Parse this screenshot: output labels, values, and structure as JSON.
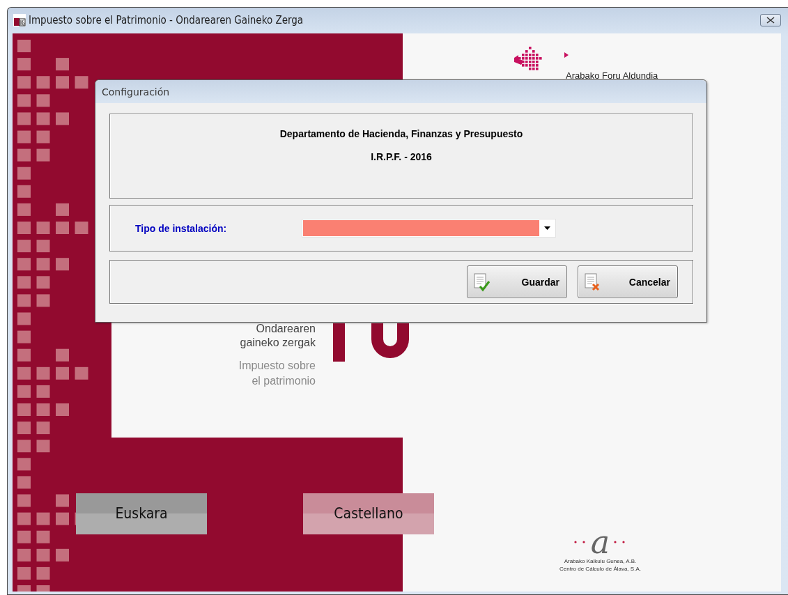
{
  "window": {
    "title": "Impuesto sobre el Patrimonio - Ondarearen Gaineko Zerga"
  },
  "splash": {
    "brand": "Arabako Foru Aldundia",
    "title_eu": [
      "Ondarearen",
      "gaineko zergak"
    ],
    "title_es": [
      "Impuesto sobre",
      "el patrimonio"
    ],
    "language_buttons": [
      {
        "label": "Euskara",
        "color": "#999999"
      },
      {
        "label": "Castellano",
        "color": "#c98c99"
      }
    ],
    "footer_logo": {
      "mark": "a",
      "lines": [
        "Arabako Kalkulu Gunea, A.B.",
        "Centro de Cálculo de Álava, S.A."
      ]
    }
  },
  "dialog": {
    "title": "Configuración",
    "heading": "Departamento de Hacienda, Finanzas y Presupuesto",
    "subheading": "I.R.P.F. - 2016",
    "field": {
      "label": "Tipo de instalación:",
      "required": true
    },
    "buttons": [
      {
        "label": "Guardar",
        "kind": "save"
      },
      {
        "label": "Cancelar",
        "kind": "cancel"
      }
    ]
  }
}
